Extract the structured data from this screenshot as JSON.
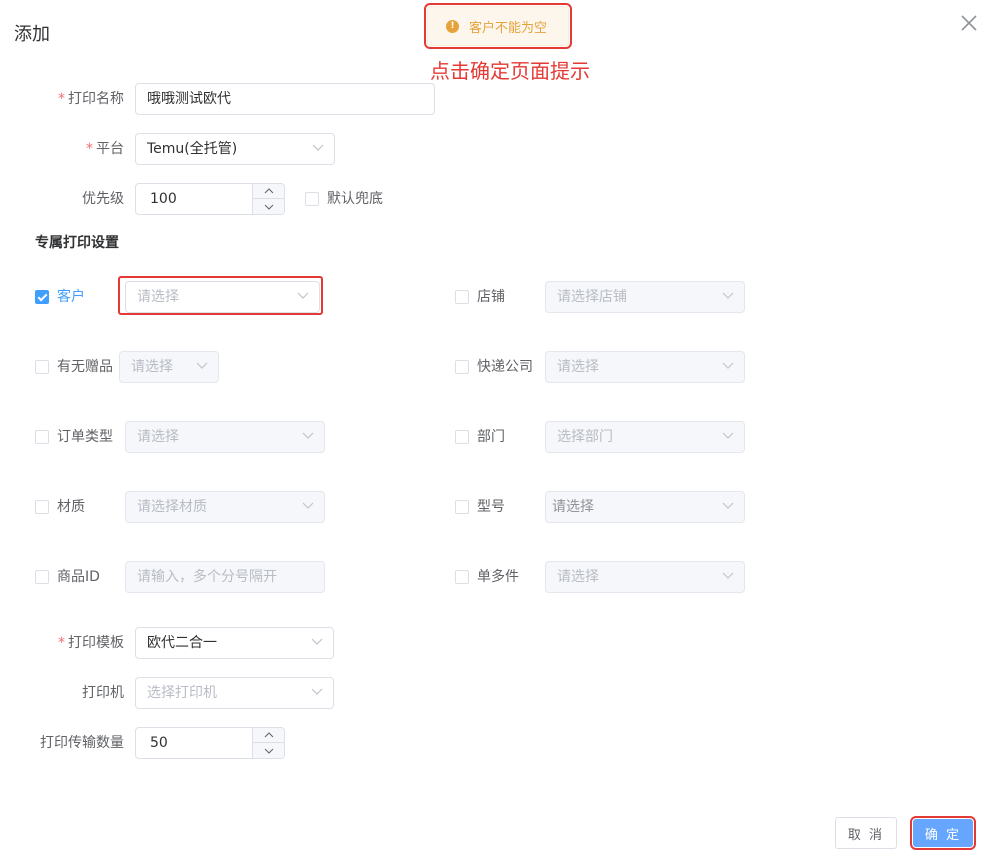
{
  "dialog": {
    "title": "添加"
  },
  "toast": {
    "icon": "warning-icon",
    "message": "客户不能为空"
  },
  "annotation": {
    "note": "点击确定页面提示"
  },
  "form": {
    "print_name": {
      "label": "打印名称",
      "value": "哦哦测试欧代",
      "required": true
    },
    "platform": {
      "label": "平台",
      "value": "Temu(全托管)",
      "required": true
    },
    "priority": {
      "label": "优先级",
      "value": "100"
    },
    "default_fallback": {
      "label": "默认兜底",
      "checked": false
    }
  },
  "exclusive": {
    "section_title": "专属打印设置",
    "customer": {
      "label": "客户",
      "checked": true,
      "placeholder": "请选择"
    },
    "shop": {
      "label": "店铺",
      "checked": false,
      "placeholder": "请选择店铺"
    },
    "gift": {
      "label": "有无赠品",
      "checked": false,
      "placeholder": "请选择"
    },
    "express": {
      "label": "快递公司",
      "checked": false,
      "placeholder": "请选择"
    },
    "order_type": {
      "label": "订单类型",
      "checked": false,
      "placeholder": "请选择"
    },
    "department": {
      "label": "部门",
      "checked": false,
      "placeholder": "选择部门"
    },
    "material": {
      "label": "材质",
      "checked": false,
      "placeholder": "请选择材质"
    },
    "model": {
      "label": "型号",
      "checked": false,
      "placeholder": "请选择"
    },
    "product_id": {
      "label": "商品ID",
      "checked": false,
      "placeholder": "请输入，多个分号隔开"
    },
    "multi_piece": {
      "label": "单多件",
      "checked": false,
      "placeholder": "请选择"
    }
  },
  "print": {
    "template": {
      "label": "打印模板",
      "value": "欧代二合一",
      "required": true
    },
    "printer": {
      "label": "打印机",
      "placeholder": "选择打印机"
    },
    "transfer_count": {
      "label": "打印传输数量",
      "value": "50"
    }
  },
  "footer": {
    "cancel_label": "取 消",
    "confirm_label": "确 定"
  },
  "colors": {
    "primary": "#409eff",
    "warning": "#e6a23c",
    "annotation_red": "#e53935"
  }
}
